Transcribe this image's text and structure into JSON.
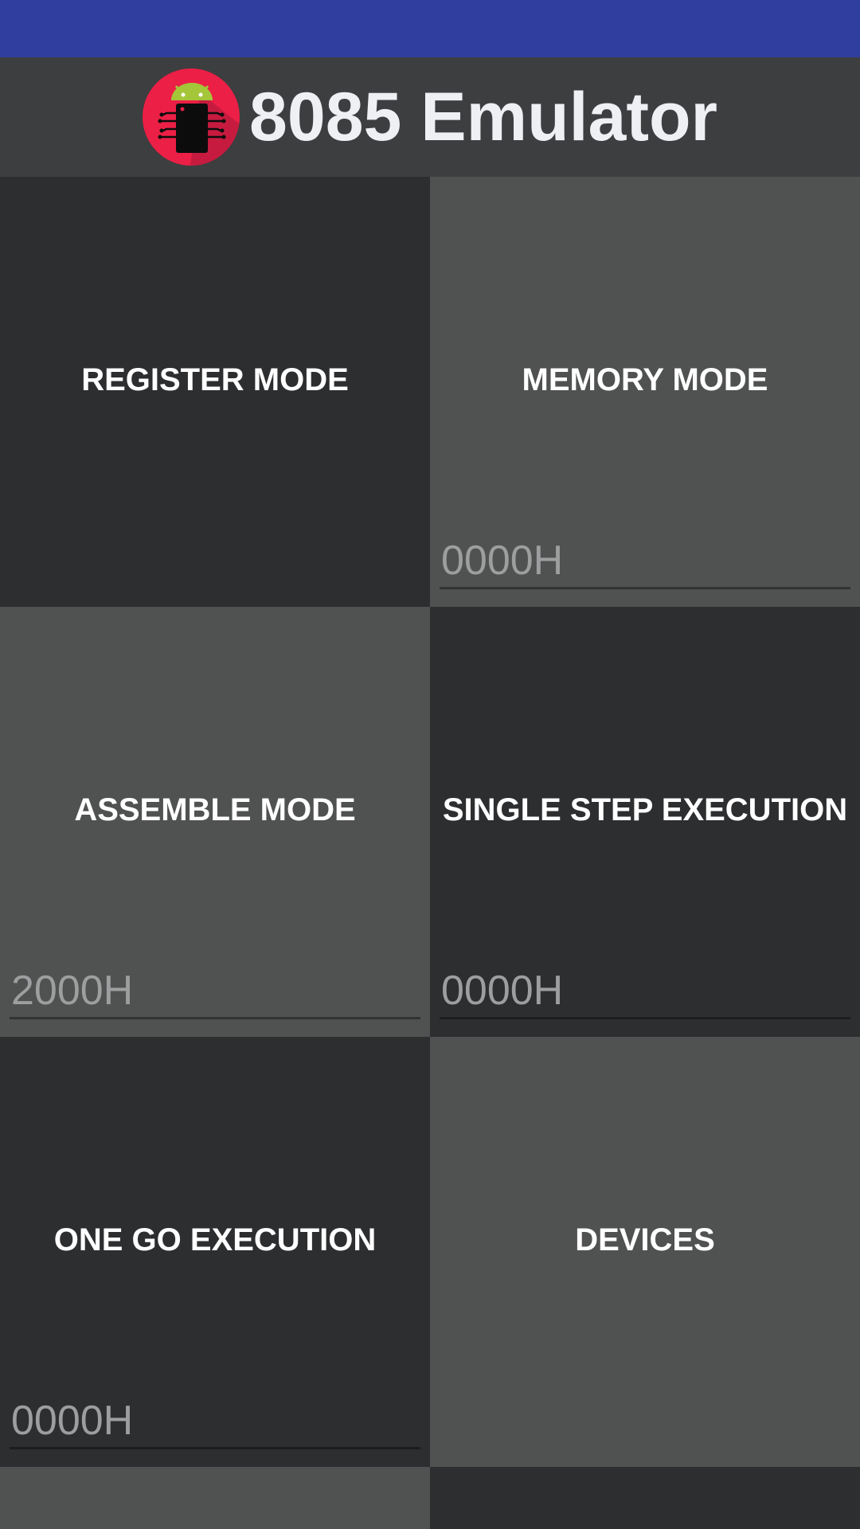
{
  "header": {
    "title": "8085 Emulator",
    "logo_icon": "android-chip-logo-icon"
  },
  "colors": {
    "status_bar": "#303f9f",
    "header_bg": "#3d3e40",
    "tile_dark": "#2d2e30",
    "tile_light": "#505251",
    "logo_circle": "#ec1f46",
    "android_green": "#a4c639"
  },
  "tiles": [
    {
      "label": "REGISTER MODE",
      "input_placeholder": null
    },
    {
      "label": "MEMORY MODE",
      "input_placeholder": "0000H"
    },
    {
      "label": "ASSEMBLE MODE",
      "input_placeholder": "2000H"
    },
    {
      "label": "SINGLE STEP EXECUTION",
      "input_placeholder": "0000H"
    },
    {
      "label": "ONE GO EXECUTION",
      "input_placeholder": "0000H"
    },
    {
      "label": "DEVICES",
      "input_placeholder": null
    }
  ]
}
